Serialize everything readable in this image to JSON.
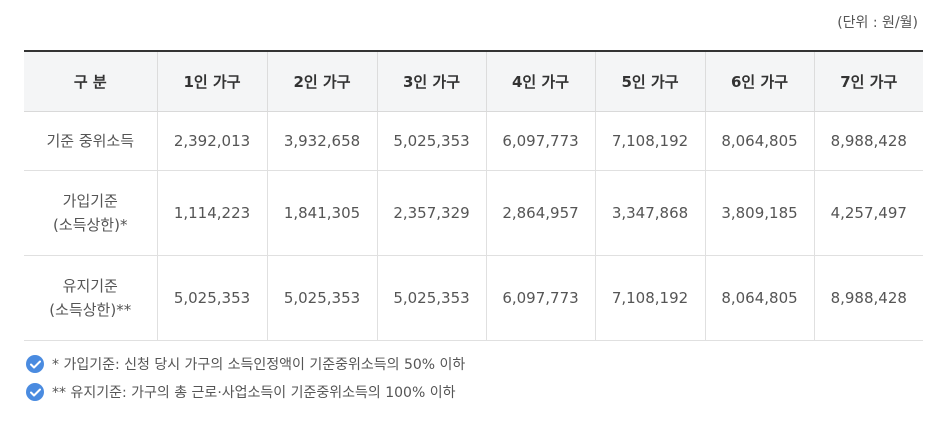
{
  "unit_label": "(단위 : 원/월)",
  "table": {
    "headers": [
      "구 분",
      "1인 가구",
      "2인 가구",
      "3인 가구",
      "4인 가구",
      "5인 가구",
      "6인 가구",
      "7인 가구"
    ],
    "rows": [
      {
        "label_lines": [
          "기준 중위소득"
        ],
        "values": [
          "2,392,013",
          "3,932,658",
          "5,025,353",
          "6,097,773",
          "7,108,192",
          "8,064,805",
          "8,988,428"
        ]
      },
      {
        "label_lines": [
          "가입기준",
          "(소득상한)*"
        ],
        "values": [
          "1,114,223",
          "1,841,305",
          "2,357,329",
          "2,864,957",
          "3,347,868",
          "3,809,185",
          "4,257,497"
        ]
      },
      {
        "label_lines": [
          "유지기준",
          "(소득상한)**"
        ],
        "values": [
          "5,025,353",
          "5,025,353",
          "5,025,353",
          "6,097,773",
          "7,108,192",
          "8,064,805",
          "8,988,428"
        ]
      }
    ]
  },
  "notes": [
    {
      "icon": "check-circle-icon",
      "text": "* 가입기준: 신청 당시 가구의 소득인정액이 기준중위소득의 50% 이하"
    },
    {
      "icon": "check-circle-icon",
      "text": "** 유지기준: 가구의 총 근로·사업소득이 기준중위소득의 100% 이하"
    }
  ],
  "colors": {
    "check_icon": "#4a8be0",
    "header_bg": "#f4f5f6"
  }
}
